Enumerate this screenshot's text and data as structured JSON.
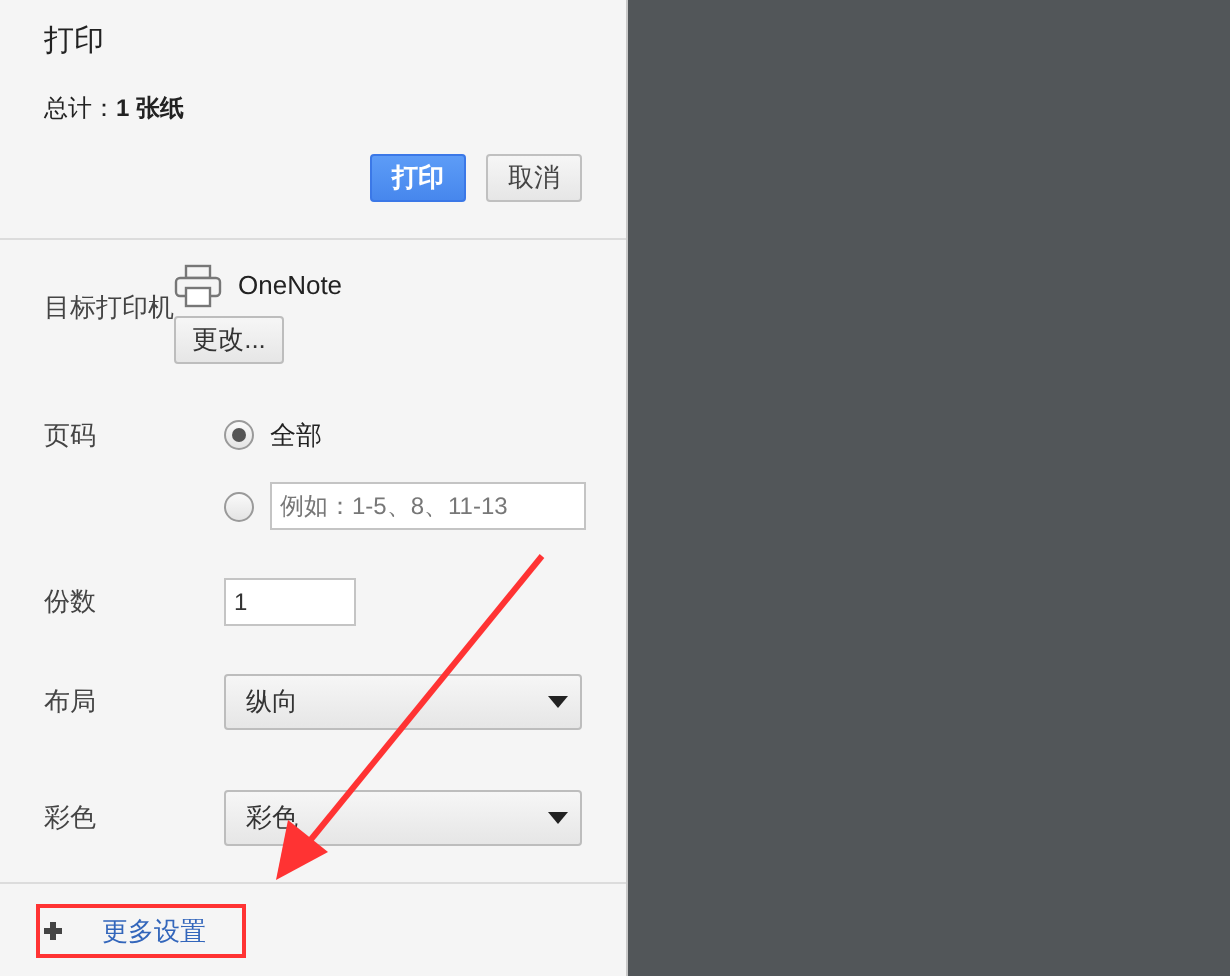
{
  "title": "打印",
  "summary": {
    "label": "总计：",
    "value": "1 张纸"
  },
  "buttons": [
    {
      "label": "打印",
      "kind": "primary"
    },
    {
      "label": "取消",
      "kind": "secondary"
    }
  ],
  "destination": {
    "label": "目标打印机",
    "printer": "OneNote",
    "change_button": "更改..."
  },
  "pages": {
    "label": "页码",
    "options": [
      {
        "kind": "label",
        "label": "全部",
        "selected": true
      },
      {
        "kind": "field",
        "placeholder": "例如：1-5、8、11-13",
        "selected": false
      }
    ]
  },
  "copies": {
    "label": "份数",
    "value": "1"
  },
  "layout": {
    "label": "布局",
    "value": "纵向"
  },
  "color": {
    "label": "彩色",
    "value": "彩色"
  },
  "more_settings": {
    "label": "更多设置",
    "expanded": false
  }
}
